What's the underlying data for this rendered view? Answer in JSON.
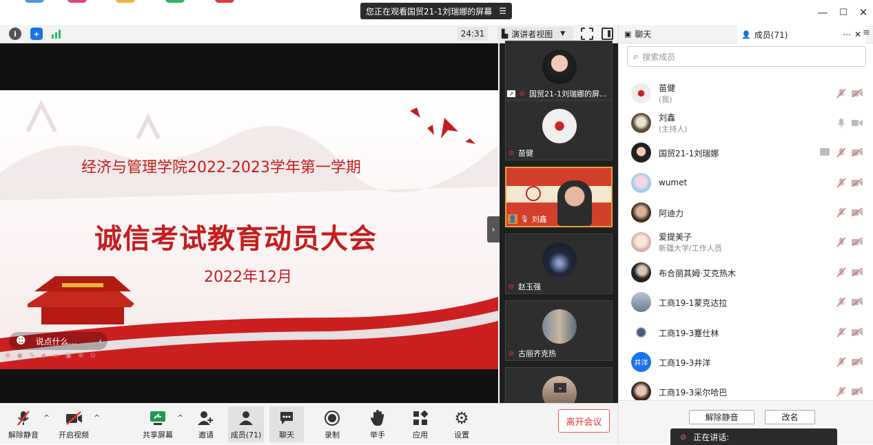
{
  "window": {
    "viewing_banner": "您正在观看国贸21-1刘瑞娜的屏幕",
    "controls": {
      "minimize": "—",
      "maximize": "☐",
      "close": "✕"
    }
  },
  "toolbar": {
    "timer": "24:31",
    "view_label": "演讲者视图"
  },
  "slide": {
    "line1": "经济与管理学院2022-2023学年第一学期",
    "line2": "诚信考试教育动员大会",
    "line3": "2022年12月",
    "chat_prompt": "说点什么..."
  },
  "gallery": {
    "tiles": [
      {
        "name": "国贸21-1刘瑞娜的屏..."
      },
      {
        "name": "苗健"
      },
      {
        "name": "刘鑫"
      },
      {
        "name": "赵玉强"
      },
      {
        "name": "古丽齐克热"
      },
      {
        "name": ""
      }
    ]
  },
  "controls": {
    "unmute": "解除静音",
    "start_video": "开启视频",
    "share_screen": "共享屏幕",
    "invite": "邀请",
    "members": "成员(71)",
    "chat": "聊天",
    "record": "录制",
    "raise_hand": "举手",
    "apps": "应用",
    "settings": "设置",
    "leave": "离开会议"
  },
  "panel": {
    "tab_chat": "聊天",
    "tab_members": "成员(71)",
    "search_placeholder": "搜索成员",
    "members": [
      {
        "name": "苗健",
        "sub": "(我)"
      },
      {
        "name": "刘鑫",
        "sub": "(主持人)"
      },
      {
        "name": "国贸21-1刘瑞娜",
        "sub": ""
      },
      {
        "name": "wumet",
        "sub": ""
      },
      {
        "name": "阿迪力",
        "sub": ""
      },
      {
        "name": "爱提美子",
        "sub": "新疆大学/工作人员"
      },
      {
        "name": "布合丽其姆·艾克热木",
        "sub": ""
      },
      {
        "name": "工商19-1蒙克达拉",
        "sub": ""
      },
      {
        "name": "工商19-3蹇仕林",
        "sub": ""
      },
      {
        "name": "工商19-3井洋",
        "sub": ""
      },
      {
        "name": "工商19-3采尔哈巴",
        "sub": ""
      }
    ],
    "avatar_text_jy": "井洋",
    "footer": {
      "unmute_all": "解除静音",
      "rename": "改名",
      "speaking": "正在讲话:"
    }
  },
  "colors": {
    "accent_red": "#c51d1d",
    "mic_off": "#e33333",
    "brand_blue": "#1a73e8"
  }
}
